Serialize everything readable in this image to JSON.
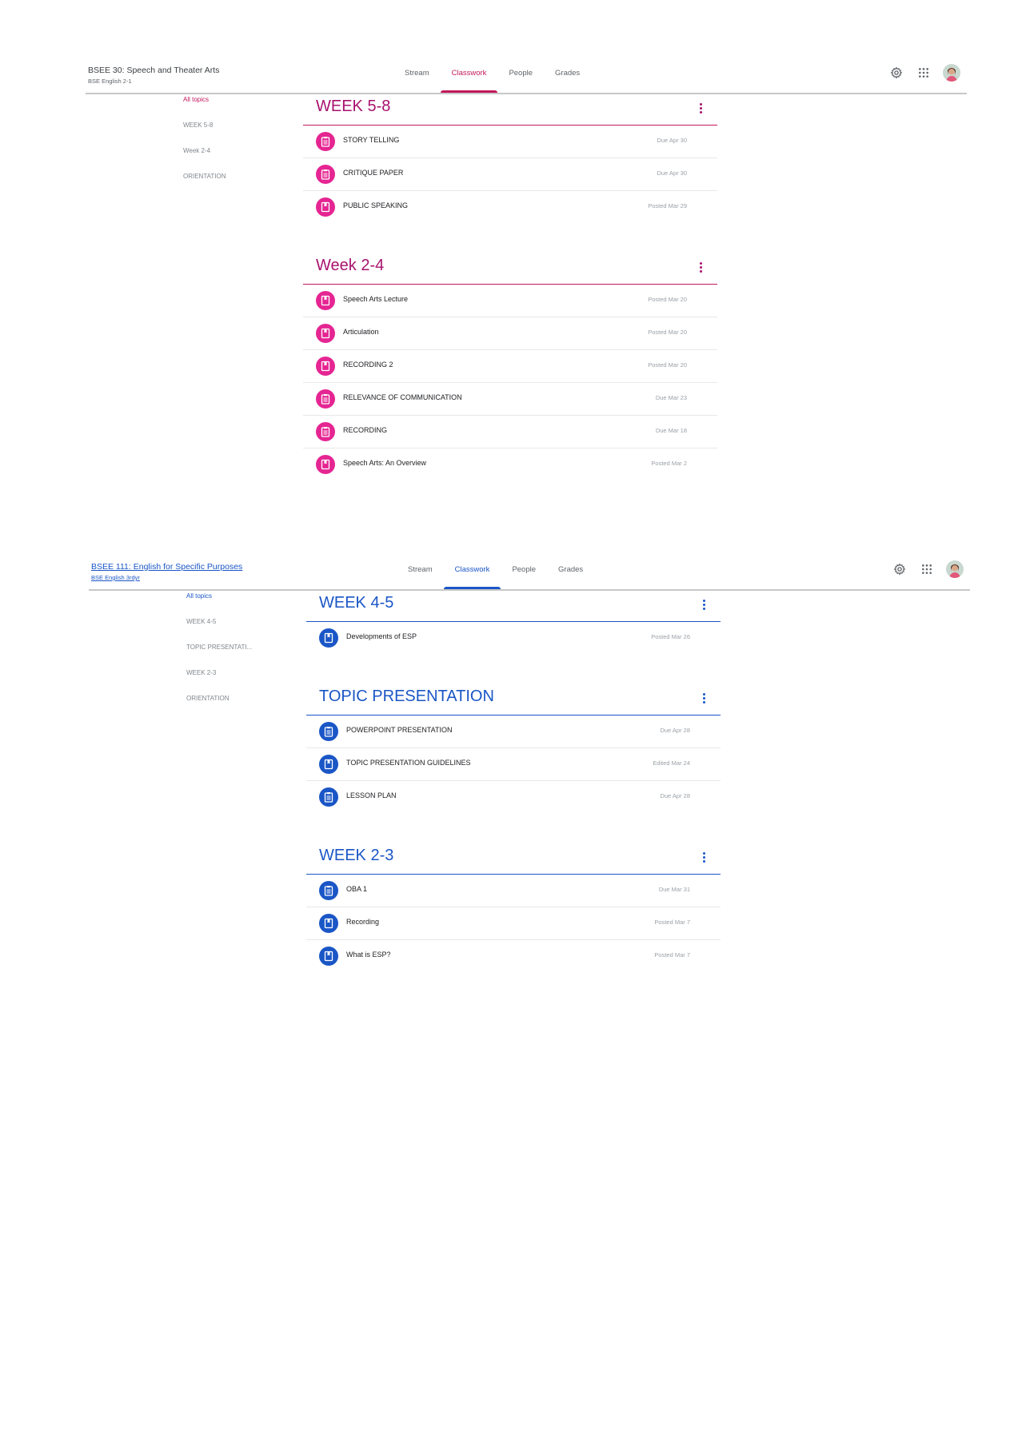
{
  "panels": [
    {
      "course_title": "BSEE 30: Speech and Theater Arts",
      "course_sub": "BSE English 2-1",
      "tabs": [
        "Stream",
        "Classwork",
        "People",
        "Grades"
      ],
      "sidebar": [
        "All topics",
        "WEEK 5-8",
        "Week 2-4",
        "ORIENTATION"
      ],
      "topics": [
        {
          "title": "WEEK 5-8",
          "items": [
            {
              "title": "STORY TELLING",
              "date": "Due Apr 30",
              "icon": "assignment-icon"
            },
            {
              "title": "CRITIQUE PAPER",
              "date": "Due Apr 30",
              "icon": "assignment-icon"
            },
            {
              "title": "PUBLIC SPEAKING",
              "date": "Posted Mar 29",
              "icon": "material-icon"
            }
          ]
        },
        {
          "title": "Week 2-4",
          "items": [
            {
              "title": "Speech Arts Lecture",
              "date": "Posted Mar 20",
              "icon": "material-icon"
            },
            {
              "title": "Articulation",
              "date": "Posted Mar 20",
              "icon": "material-icon"
            },
            {
              "title": "RECORDING 2",
              "date": "Posted Mar 20",
              "icon": "material-icon"
            },
            {
              "title": "RELEVANCE OF COMMUNICATION",
              "date": "Due Mar 23",
              "icon": "assignment-icon"
            },
            {
              "title": "RECORDING",
              "date": "Due Mar 18",
              "icon": "assignment-icon"
            },
            {
              "title": "Speech Arts: An Overview",
              "date": "Posted Mar 2",
              "icon": "material-icon"
            }
          ]
        }
      ],
      "accent": "#c2185b"
    },
    {
      "course_title": "BSEE 111: English for Specific Purposes",
      "course_sub": "BSE English 3rdyr",
      "tabs": [
        "Stream",
        "Classwork",
        "People",
        "Grades"
      ],
      "sidebar": [
        "All topics",
        "WEEK 4-5",
        "TOPIC PRESENTATI...",
        "WEEK 2-3",
        "ORIENTATION"
      ],
      "topics": [
        {
          "title": "WEEK 4-5",
          "items": [
            {
              "title": "Developments of ESP",
              "date": "Posted Mar 26",
              "icon": "material-icon"
            }
          ]
        },
        {
          "title": "TOPIC PRESENTATION",
          "items": [
            {
              "title": "POWERPOINT PRESENTATION",
              "date": "Due Apr 28",
              "icon": "assignment-icon"
            },
            {
              "title": "TOPIC PRESENTATION GUIDELINES",
              "date": "Edited Mar 24",
              "icon": "material-icon"
            },
            {
              "title": "LESSON PLAN",
              "date": "Due Apr 28",
              "icon": "assignment-icon"
            }
          ]
        },
        {
          "title": "WEEK 2-3",
          "items": [
            {
              "title": "OBA 1",
              "date": "Due Mar 31",
              "icon": "assignment-icon"
            },
            {
              "title": "Recording",
              "date": "Posted Mar 7",
              "icon": "material-icon"
            },
            {
              "title": "What is ESP?",
              "date": "Posted Mar 7",
              "icon": "material-icon"
            }
          ]
        }
      ],
      "accent": "#1a56c6"
    }
  ]
}
